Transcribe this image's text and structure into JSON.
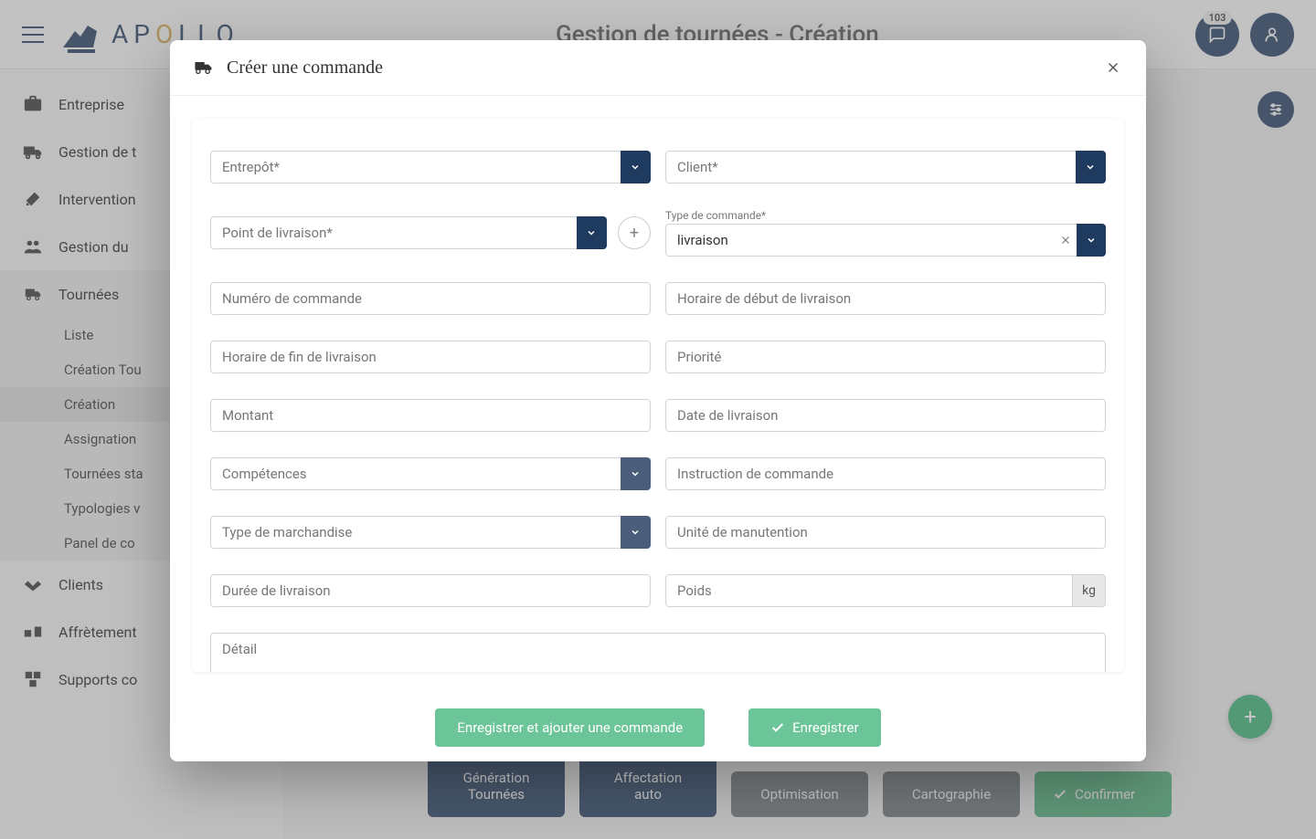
{
  "header": {
    "page_title": "Gestion de tournées - Création",
    "notifications_count": "103"
  },
  "sidebar": {
    "items": [
      {
        "label": "Entreprise"
      },
      {
        "label": "Gestion de t"
      },
      {
        "label": "Intervention"
      },
      {
        "label": "Gestion du "
      },
      {
        "label": "Tournées"
      },
      {
        "label": "Clients"
      },
      {
        "label": "Affrètement"
      },
      {
        "label": "Supports co"
      }
    ],
    "subitems": [
      {
        "label": "Liste"
      },
      {
        "label": "Création Tou"
      },
      {
        "label": "Création"
      },
      {
        "label": "Assignation"
      },
      {
        "label": "Tournées sta"
      },
      {
        "label": "Typologies v"
      },
      {
        "label": "Panel de co"
      }
    ]
  },
  "bottom_buttons": {
    "gen": "Génération\nTournées",
    "affect": "Affectation\nauto",
    "opt": "Optimisation",
    "carto": "Cartographie",
    "confirm": "Confirmer"
  },
  "modal": {
    "title": "Créer une commande",
    "fields": {
      "entrepot": "Entrepôt*",
      "client": "Client*",
      "point_livraison": "Point de livraison*",
      "type_commande_label": "Type de commande*",
      "type_commande_value": "livraison",
      "numero": "Numéro de commande",
      "horaire_debut": "Horaire de début de livraison",
      "horaire_fin": "Horaire de fin de livraison",
      "priorite": "Priorité",
      "montant": "Montant",
      "date_livraison": "Date de livraison",
      "competences": "Compétences",
      "instruction": "Instruction de commande",
      "type_marchandise": "Type de marchandise",
      "unite": "Unité de manutention",
      "duree": "Durée de livraison",
      "poids": "Poids",
      "poids_unit": "kg",
      "detail": "Détail"
    },
    "buttons": {
      "save_add": "Enregistrer et ajouter une commande",
      "save": "Enregistrer"
    }
  }
}
